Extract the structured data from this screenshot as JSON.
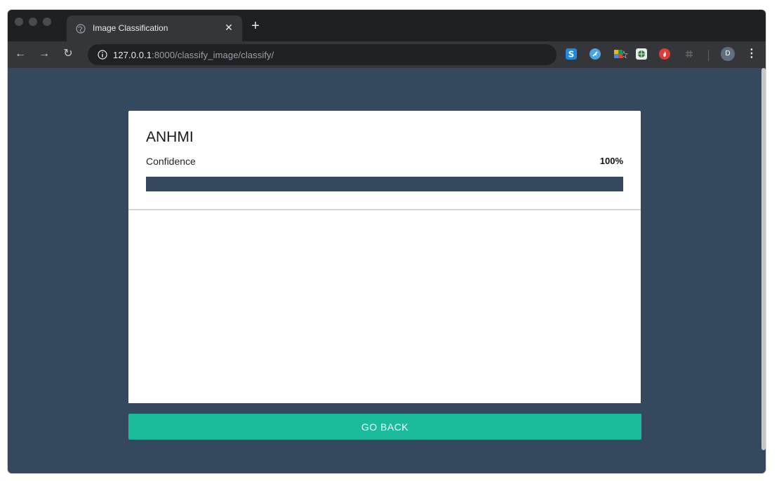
{
  "browser": {
    "tab_title": "Image Classification",
    "url_host": "127.0.0.1",
    "url_rest": ":8000/classify_image/classify/",
    "profile_initial": "D",
    "extensions": [
      "s-ext-icon",
      "feather-ext-icon",
      "colorful-ext-icon",
      "globe-ext-icon",
      "flame-ext-icon",
      "grid-ext-icon"
    ]
  },
  "result": {
    "label": "ANHMI",
    "confidence_label": "Confidence",
    "confidence_text": "100%",
    "confidence_fraction": 1.0
  },
  "actions": {
    "go_back_label": "GO BACK"
  },
  "colors": {
    "page_bg": "#34495e",
    "progress_fill": "#34495e",
    "button_bg": "#1abc9c"
  }
}
